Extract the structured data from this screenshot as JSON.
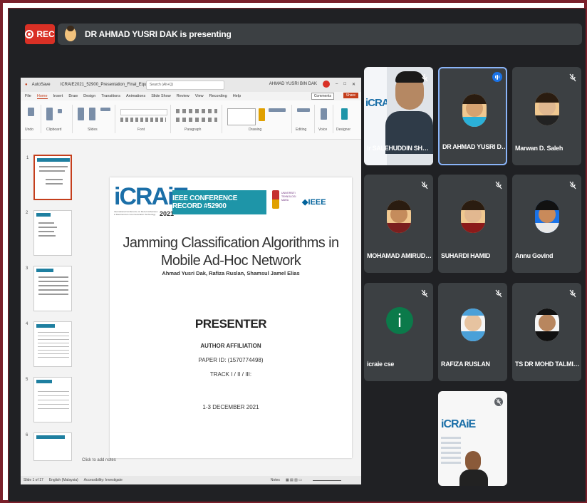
{
  "recording": {
    "label": "REC"
  },
  "presenter_bar": {
    "text": "DR AHMAD YUSRI DAK is presenting"
  },
  "powerpoint": {
    "titlebar": {
      "autosave": "AutoSave",
      "filename": "ICRAIE2021_52900_Presentation_Final_Equ...",
      "search_placeholder": "Search (Alt+Q)",
      "user": "AHMAD YUSRI BIN DAK"
    },
    "menu": [
      "File",
      "Home",
      "Insert",
      "Draw",
      "Design",
      "Transitions",
      "Animations",
      "Slide Show",
      "Review",
      "View",
      "Recording",
      "Help"
    ],
    "comments_label": "Comments",
    "share_label": "Share",
    "ribbon_groups": [
      "Undo",
      "Clipboard",
      "Slides",
      "Font",
      "Paragraph",
      "Drawing",
      "Editing",
      "Voice",
      "Designer"
    ],
    "thumb_numbers": [
      "1",
      "2",
      "3",
      "4",
      "5",
      "6"
    ],
    "slide": {
      "logo": "iCRAiE",
      "logo_year": "2021",
      "logo_sub": "International Conference on Recent Advances in Electronics & Communication Technology",
      "conference_box": "IEEE CONFERENCE RECORD #52900",
      "university": "UNIVERSITI TEKNOLOGI MARA",
      "ieee": "◆IEEE",
      "title_line1": "Jamming Classification Algorithms in",
      "title_line2": "Mobile Ad-Hoc Network",
      "authors": "Ahmad Yusri Dak, Rafiza Ruslan, Shamsul Jamel Elias",
      "presenter": "PRESENTER",
      "affiliation": "AUTHOR AFFILIATION",
      "paper_id": "PAPER ID: (1570774498)",
      "track": "TRACK I / II / III:",
      "date": "1-3 DECEMBER 2021"
    },
    "notes": "Click to add notes",
    "status": {
      "slide_of": "Slide 1 of 17",
      "language": "English (Malaysia)",
      "accessibility": "Accessibility: Investigate",
      "notes_btn": "Notes"
    }
  },
  "participants": [
    {
      "name": "Ir SALEHUDDIN SHUIB",
      "muted": true,
      "video": true
    },
    {
      "name": "DR AHMAD YUSRI DAK",
      "muted": false,
      "speaking": true
    },
    {
      "name": "Marwan D. Saleh",
      "muted": true
    },
    {
      "name": "MOHAMAD AMIRUDDIN...",
      "muted": true
    },
    {
      "name": "SUHARDI HAMID",
      "muted": true
    },
    {
      "name": "Annu Govind",
      "muted": true
    },
    {
      "name": "icraie cse",
      "muted": true,
      "initial": "i"
    },
    {
      "name": "RAFIZA RUSLAN",
      "muted": true
    },
    {
      "name": "TS DR MOHD TALMIZIE ...",
      "muted": true
    },
    {
      "name": "",
      "muted": true,
      "video": true
    }
  ],
  "colors": {
    "rec": "#d93025",
    "tile": "#3c4043",
    "bg": "#202124",
    "accent": "#8ab4f8",
    "ppt": "#c43e1c"
  }
}
